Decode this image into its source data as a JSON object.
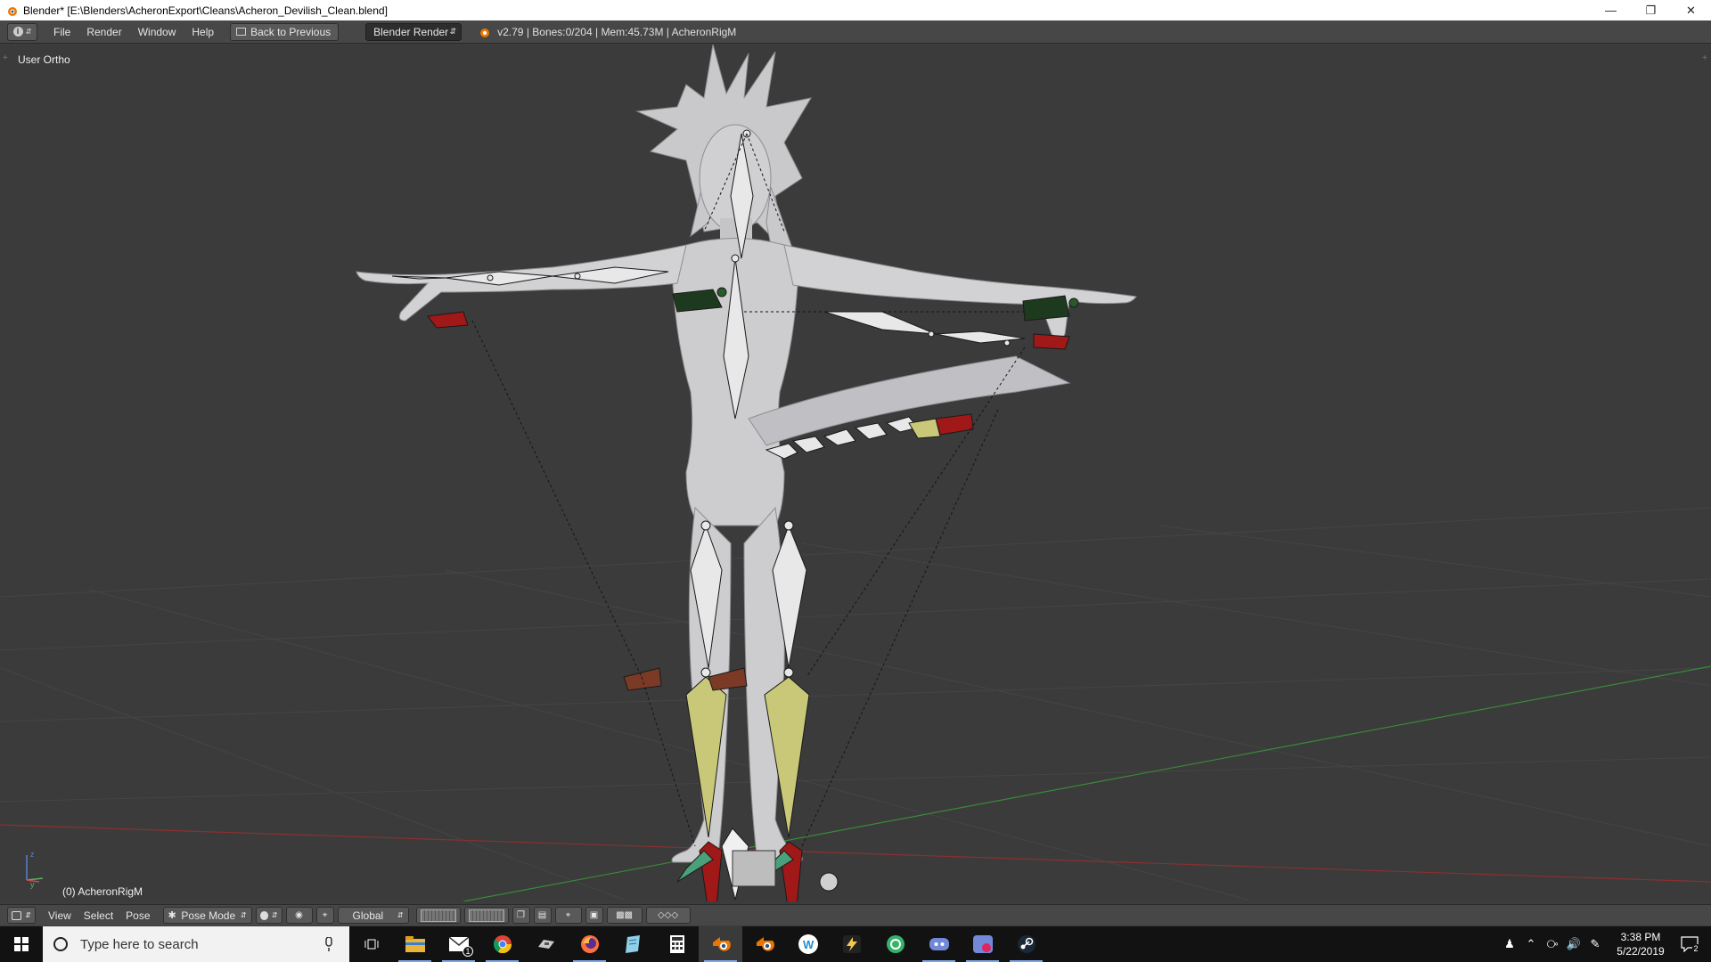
{
  "window": {
    "title": "Blender* [E:\\Blenders\\AcheronExport\\Cleans\\Acheron_Devilish_Clean.blend]",
    "controls": [
      "minimize",
      "restore",
      "close"
    ]
  },
  "info_bar": {
    "menus": [
      "File",
      "Render",
      "Window",
      "Help"
    ],
    "back_label": "Back to Previous",
    "render_engine": "Blender Render",
    "stats": "v2.79 | Bones:0/204 | Mem:45.73M | AcheronRigM"
  },
  "viewport": {
    "view_label": "User Ortho",
    "object_label": "(0) AcheronRigM",
    "axis_x": "x",
    "axis_y": "y",
    "axis_z": "z"
  },
  "bottom_bar": {
    "menus": [
      "View",
      "Select",
      "Pose"
    ],
    "mode": "Pose Mode",
    "orientation": "Global"
  },
  "taskbar": {
    "search_placeholder": "Type here to search",
    "mail_badge": "1",
    "time": "3:38 PM",
    "date": "5/22/2019",
    "notification_count": "2",
    "apps": [
      "file-explorer",
      "mail",
      "chrome",
      "game-app",
      "firefox",
      "notepad-app",
      "calculator",
      "blender-active",
      "blender",
      "webstorm-app",
      "lightning-app",
      "green-app",
      "discord-app",
      "app-red",
      "steam"
    ]
  },
  "colors": {
    "viewport_bg": "#3b3b3b",
    "header_bg": "#474747",
    "taskbar_bg": "#121212",
    "bone_selected_red": "#a01818",
    "bone_yellow": "#c8c878",
    "bone_green": "#1e3a1e",
    "axis_red": "#8a3030",
    "axis_green": "#3a8a3a"
  }
}
